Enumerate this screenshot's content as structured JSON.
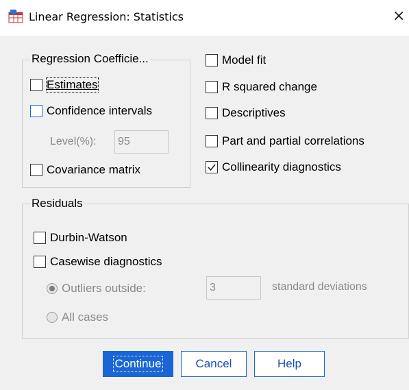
{
  "window": {
    "title": "Linear Regression: Statistics",
    "close_glyph": "×",
    "app_icon": "spss-table-icon"
  },
  "regression_coefficients": {
    "legend": "Regression Coefficie...",
    "estimates": {
      "label": "Estimates",
      "checked": false
    },
    "confidence_intervals": {
      "label": "Confidence intervals",
      "checked": false
    },
    "level_label": "Level(%):",
    "level_value": "95",
    "covariance_matrix": {
      "label": "Covariance matrix",
      "checked": false
    }
  },
  "options": {
    "model_fit": {
      "label": "Model fit",
      "checked": false
    },
    "r_squared_change": {
      "label": "R squared change",
      "checked": false
    },
    "descriptives": {
      "label": "Descriptives",
      "checked": false
    },
    "part_partial": {
      "label": "Part and partial correlations",
      "checked": false
    },
    "collinearity": {
      "label": "Collinearity diagnostics",
      "checked": true
    }
  },
  "residuals": {
    "legend": "Residuals",
    "durbin_watson": {
      "label": "Durbin-Watson",
      "checked": false
    },
    "casewise": {
      "label": "Casewise diagnostics",
      "checked": false
    },
    "outliers_label": "Outliers outside:",
    "outliers_value": "3",
    "std_dev_label": "standard deviations",
    "all_cases_label": "All cases",
    "selected_option": "outliers"
  },
  "buttons": {
    "continue": "Continue",
    "cancel": "Cancel",
    "help": "Help"
  },
  "colors": {
    "accent": "#1a66d6",
    "dialog_bg": "#f0f0f0",
    "disabled_text": "#8a8a8a"
  }
}
